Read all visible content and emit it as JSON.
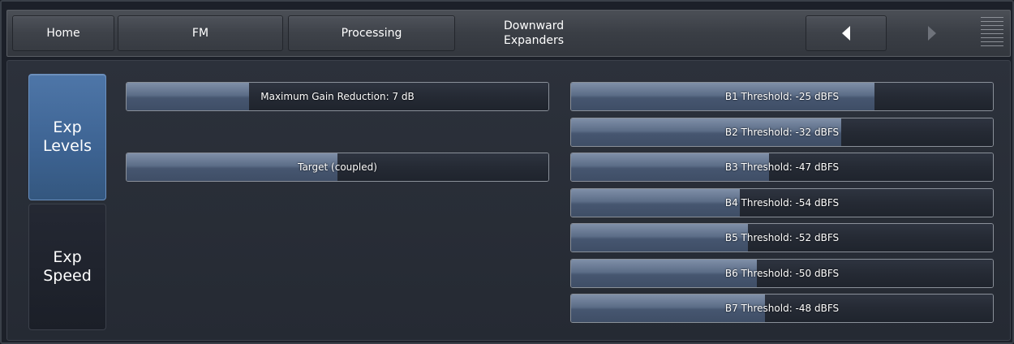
{
  "topbar": {
    "home_label": "Home",
    "fm_label": "FM",
    "processing_label": "Processing",
    "title_line1": "Downward",
    "title_line2": "Expanders"
  },
  "sidebar": {
    "items": [
      {
        "line1": "Exp",
        "line2": "Levels",
        "active": true
      },
      {
        "line1": "Exp",
        "line2": "Speed",
        "active": false
      }
    ]
  },
  "left_controls": [
    {
      "label": "Maximum Gain Reduction: 7 dB",
      "fill_fraction": 0.29
    },
    {
      "label": "Target (coupled)",
      "fill_fraction": 0.5
    }
  ],
  "thresholds": [
    {
      "label": "B1 Threshold: -25 dBFS",
      "fill_fraction": 0.72
    },
    {
      "label": "B2 Threshold: -32 dBFS",
      "fill_fraction": 0.64
    },
    {
      "label": "B3 Threshold: -47 dBFS",
      "fill_fraction": 0.47
    },
    {
      "label": "B4 Threshold: -54 dBFS",
      "fill_fraction": 0.4
    },
    {
      "label": "B5 Threshold: -52 dBFS",
      "fill_fraction": 0.42
    },
    {
      "label": "B6 Threshold: -50 dBFS",
      "fill_fraction": 0.44
    },
    {
      "label": "B7 Threshold: -48 dBFS",
      "fill_fraction": 0.46
    }
  ],
  "icons": {
    "prev": "triangle-left-icon",
    "next": "triangle-right-icon",
    "menu": "hamburger-menu-icon"
  },
  "colors": {
    "active_tab": "#3d6392",
    "slider_fill": "#5c6d87",
    "background": "#1c2029"
  }
}
